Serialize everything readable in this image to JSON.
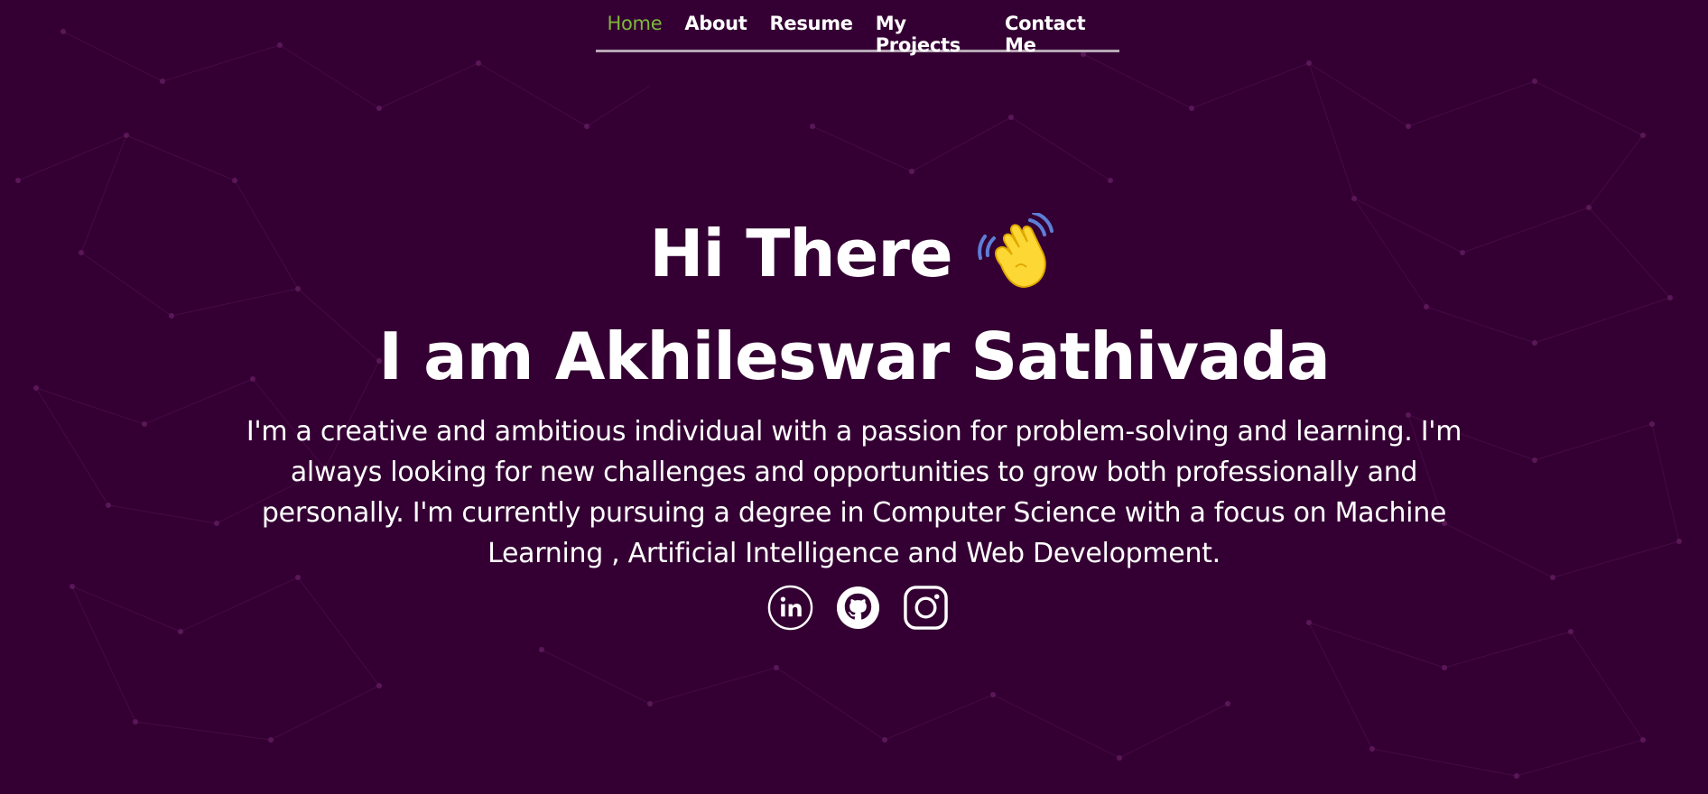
{
  "nav": {
    "items": [
      {
        "label": "Home",
        "active": true
      },
      {
        "label": "About",
        "active": false
      },
      {
        "label": "Resume",
        "active": false
      },
      {
        "label": "My Projects",
        "active": false
      },
      {
        "label": "Contact Me",
        "active": false
      }
    ]
  },
  "hero": {
    "greeting": "Hi There",
    "greeting_icon": "waving-hand-icon",
    "name_line": "I am Akhileswar Sathivada",
    "intro": "I'm a creative and ambitious individual with a passion for problem-solving and learning. I'm always looking for new challenges and opportunities to grow both professionally and personally. I'm currently pursuing a degree in Computer Science with a focus on Machine Learning , Artificial Intelligence and Web Development."
  },
  "socials": [
    {
      "icon": "linkedin-icon"
    },
    {
      "icon": "github-icon"
    },
    {
      "icon": "instagram-icon"
    }
  ],
  "colors": {
    "background": "#340033",
    "text": "#ffffff",
    "nav_active": "#7eb73a",
    "nav_underline": "#b7a8b6",
    "network": "#5a1a5a"
  }
}
